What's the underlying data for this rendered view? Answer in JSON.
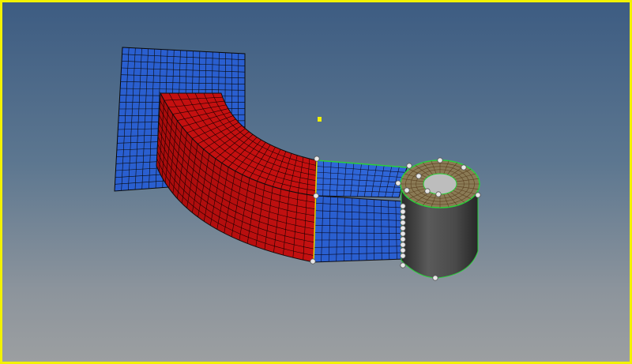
{
  "viewport": {
    "border_color": "#f2f200",
    "background_top": "#3d5c82",
    "background_bottom": "#9c9fa1"
  },
  "model": {
    "parts": [
      {
        "name": "back-plate",
        "color": "#2a5fd0"
      },
      {
        "name": "curved-block",
        "color": "#c41010"
      },
      {
        "name": "straight-section",
        "color": "#2a5fd0"
      },
      {
        "name": "cylinder",
        "color": "#3e3e3e"
      },
      {
        "name": "cylinder-top-ring",
        "color": "#8a7a55"
      }
    ],
    "mesh_line_color": "#101010",
    "highlight_edge_color": "#2ad13a",
    "node_marker_color": "#dcdcdc",
    "selected_point_color": "#f0f000"
  }
}
